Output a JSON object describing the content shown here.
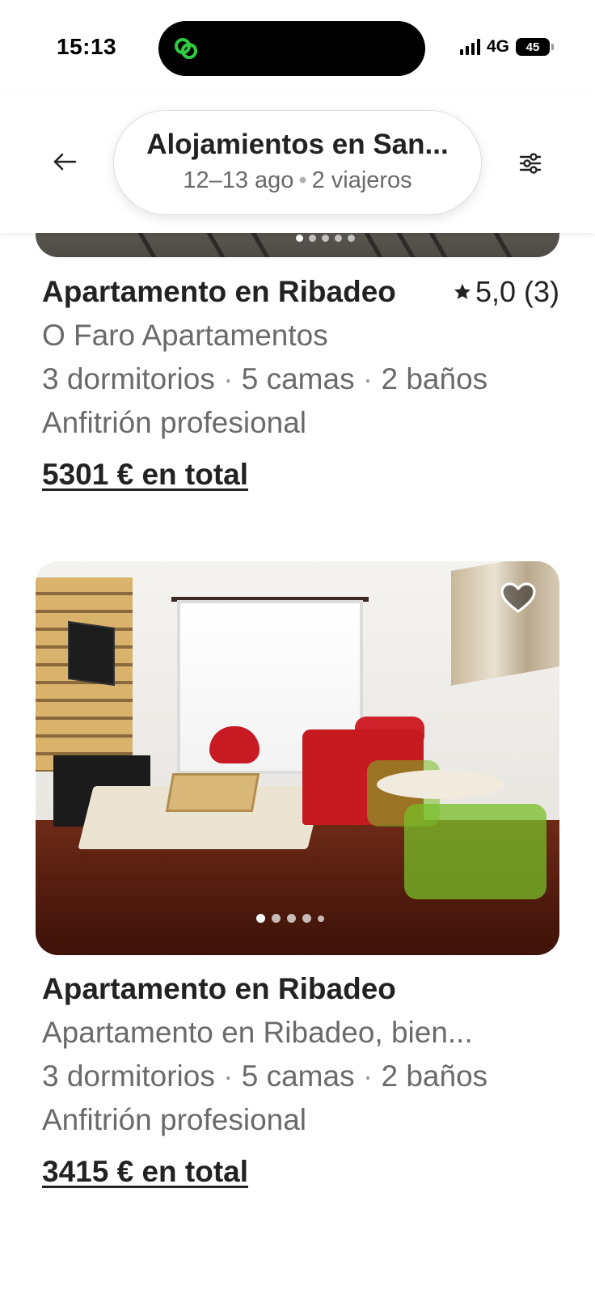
{
  "status_bar": {
    "time": "15:13",
    "network": "4G",
    "battery": "45",
    "battery_level_percent": 45
  },
  "header": {
    "title": "Alojamientos en San...",
    "dates": "12–13 ago",
    "separator": "•",
    "guests": "2 viajeros",
    "icons": {
      "back": "arrow-left-icon",
      "filters": "sliders-icon"
    }
  },
  "listings": [
    {
      "title": "Apartamento en Ribadeo",
      "rating": "5,0 (3)",
      "name": "O Faro Apartamentos",
      "bedrooms": "3 dormitorios",
      "beds": "5 camas",
      "baths": "2 baños",
      "host": "Anfitrión profesional",
      "price": "5301 € en total",
      "photo_count": 5,
      "active_photo": 1
    },
    {
      "title": "Apartamento en Ribadeo",
      "name": "Apartamento en Ribadeo, bien...",
      "bedrooms": "3 dormitorios",
      "beds": "5 camas",
      "baths": "2 baños",
      "host": "Anfitrión profesional",
      "price": "3415 € en total",
      "photo_count": 5,
      "active_photo": 1,
      "favorite": false
    }
  ],
  "separators": {
    "dot": "·"
  },
  "colors": {
    "text_primary": "#222222",
    "text_secondary": "#6a6a6a",
    "island_accent": "#2ecc40"
  }
}
